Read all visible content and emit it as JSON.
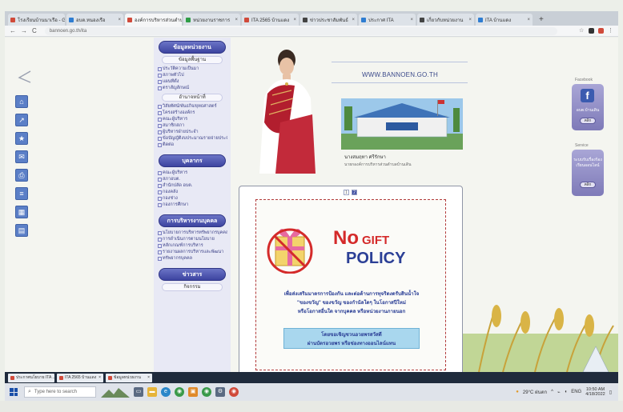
{
  "browser": {
    "tabs": [
      {
        "label": "โรงเรียนบ้านนาเรือ - Google",
        "active": false
      },
      {
        "label": "อบต.หนองเรือ",
        "active": false
      },
      {
        "label": "องค์การบริหารส่วนตำบล",
        "active": true
      },
      {
        "label": "หน่วยงานราชการ",
        "active": false
      },
      {
        "label": "ITA 2565 บ้านแดง",
        "active": false
      },
      {
        "label": "ข่าวประชาสัมพันธ์",
        "active": false
      },
      {
        "label": "ประกาศ ITA",
        "active": false
      },
      {
        "label": "เกี่ยวกับหน่วยงาน",
        "active": false
      },
      {
        "label": "ITA บ้านแดง",
        "active": false
      }
    ],
    "new_tab_label": "+",
    "url": "bannoen.go.th/ita",
    "nav_back": "←",
    "nav_forward": "→",
    "nav_reload": "C"
  },
  "nav": {
    "sections": [
      {
        "heading": "ข้อมูลหน่วยงาน",
        "sub": "ข้อมูลพื้นฐาน",
        "items": [
          "ประวัติความเป็นมา",
          "สภาพทั่วไป",
          "แผนที่ตั้ง",
          "ตราสัญลักษณ์"
        ],
        "sub2": "อำนาจหน้าที่",
        "items2": [
          "วิสัยทัศน์/พันธกิจ/ยุทธศาสตร์",
          "โครงสร้างองค์กร",
          "คณะผู้บริหาร",
          "สมาชิกสภา",
          "ผู้บริหารฝ่ายประจำ",
          "ข้อบัญญัติงบประมาณรายจ่ายประจำปี",
          "ติดต่อ"
        ]
      },
      {
        "heading": "บุคลากร",
        "items": [
          "คณะผู้บริหาร",
          "สภาอบต.",
          "สำนักปลัด อบต.",
          "กองคลัง",
          "กองช่าง",
          "กองการศึกษา"
        ]
      },
      {
        "heading": "การบริหารงานบุคคล",
        "items": [
          "นโยบายการบริหารทรัพยากรบุคคล",
          "การดำเนินการตามนโยบาย",
          "หลักเกณฑ์การบริหาร",
          "รายงานผลการบริหารและพัฒนา",
          "ทรัพยากรบุคคล"
        ]
      },
      {
        "heading": "ข่าวสาร",
        "sub": "กิจกรรม",
        "items": []
      }
    ]
  },
  "banner": {
    "site_url": "WWW.BANNOEN.GO.TH",
    "person_name": "นางสมฤทา ศรีรักษา",
    "person_title": "นายกองค์การบริหารส่วนตำบลบ้านเดิน"
  },
  "poster": {
    "pages": [
      "1",
      "2"
    ],
    "no_word": "No",
    "gift_word": "GIFT",
    "policy_word": "POLICY",
    "thai_line1": "เพื่อส่งเสริมมาตรการป้องกัน และต่อต้านการทุจริตงดรับสินน้ำใจ",
    "thai_line2": "\"ของขวัญ\" ของขวัญ ของกำนัลใดๆ ในโอกาสปีใหม่",
    "thai_line3": "หรือโอกาสอื่นใด จากบุคคล หรือหน่วยงานภายนอก",
    "box_line1": "โดยขอเชิญชวนอวยพรสวัสดี",
    "box_line2": "ผ่านบัตรอวยพร หรือช่องทางออนไลน์แทน"
  },
  "right": {
    "fb_label": "Facebook",
    "fb_icon": "f",
    "fb_text": "อบต.บ้านเดิน",
    "fb_pill": "คลิก",
    "svc_label": "Service",
    "svc_text": "ระบบรับเรื่องร้องเรียนออนไลน์",
    "svc_pill": "คลิก"
  },
  "app_strip": [
    {
      "label": "ประกาศนโยบาย ITA ..."
    },
    {
      "label": "ITA 2565 บ้านแดง"
    },
    {
      "label": "ข้อมูลหน่วยงาน"
    }
  ],
  "taskbar": {
    "search_placeholder": "Type here to search",
    "weather": "29°C ฝนตก",
    "time": "10:50 AM",
    "date": "4/18/2022",
    "lang": "ENG"
  },
  "colors": {
    "nav_heading": "#3d44a0",
    "poster_red": "#d42a2a",
    "poster_blue": "#2b3f96",
    "facebook": "#3b5bb0"
  }
}
